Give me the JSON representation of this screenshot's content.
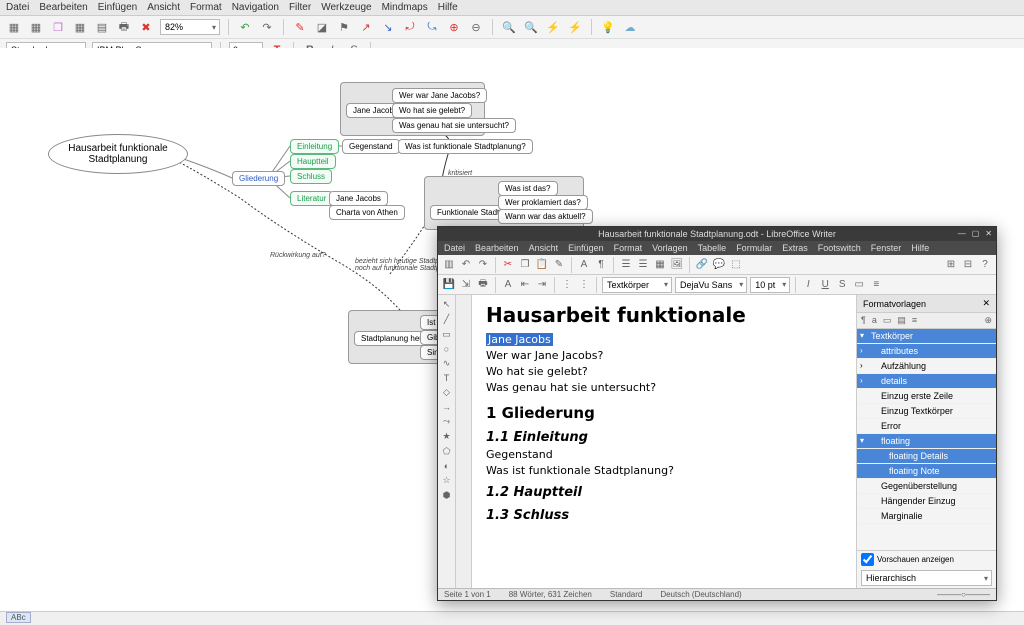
{
  "freeplane": {
    "menu": [
      "Datei",
      "Bearbeiten",
      "Einfügen",
      "Ansicht",
      "Format",
      "Navigation",
      "Filter",
      "Werkzeuge",
      "Mindmaps",
      "Hilfe"
    ],
    "zoom": "82%",
    "style_combo": "Standard",
    "font_combo": "IBM Plex Sans",
    "size_spin": "0",
    "status_abc": "ABc",
    "root": "Hausarbeit funktionale Stadtplanung",
    "gliederung": "Gliederung",
    "einleitung": "Einleitung",
    "hauptteil": "Hauptteil",
    "schluss": "Schluss",
    "literatur": "Literatur",
    "lit_items": [
      "Jane Jacobs",
      "Charta von Athen"
    ],
    "gegenstand": "Gegenstand",
    "was_ist": "Was ist funktionale Stadtplanung?",
    "jane_jacobs": "Jane Jacobs",
    "jj_q": [
      "Wer war Jane Jacobs?",
      "Wo hat sie gelebt?",
      "Was genau hat sie untersucht?"
    ],
    "funktionale": "Funktionale Stadtplanung",
    "f_q": [
      "Was ist das?",
      "Wer proklamiert das?",
      "Wann war das aktuell?"
    ],
    "ruckwirkung": "Rückwirkung auf?",
    "bezieht": "bezieht sich heutige Stadtplanung noch auf funktionale Stadtplanung?",
    "kritisiert": "kritisiert",
    "heute": "Stadtplanung heute",
    "heute_items": [
      "Ist fu…",
      "Gibt es…",
      "Sind u…"
    ]
  },
  "libre": {
    "title": "Hausarbeit funktionale Stadtplanung.odt - LibreOffice Writer",
    "menu": [
      "Datei",
      "Bearbeiten",
      "Ansicht",
      "Einfügen",
      "Format",
      "Vorlagen",
      "Tabelle",
      "Formular",
      "Extras",
      "Footswitch",
      "Fenster",
      "Hilfe"
    ],
    "para_style": "Textkörper",
    "font": "DejaVu Sans",
    "size": "10 pt",
    "doc": {
      "h1": "Hausarbeit funktionale",
      "sel": "Jane Jacobs",
      "p1": "Wer war Jane Jacobs?",
      "p2": "Wo hat sie gelebt?",
      "p3": "Was genau hat sie untersucht?",
      "h2_1": "1  Gliederung",
      "h3_11": "1.1  Einleitung",
      "p_g": "Gegenstand",
      "p_w": "Was ist funktionale Stadtplanung?",
      "h3_12": "1.2  Hauptteil",
      "h3_13": "1.3  Schluss"
    },
    "styles_title": "Formatvorlagen",
    "styles": [
      {
        "t": "Textkörper",
        "hl": true,
        "chev": "▾"
      },
      {
        "t": "attributes",
        "hl": true,
        "chev": "›",
        "indent": 1
      },
      {
        "t": "Aufzählung",
        "chev": "›",
        "indent": 1
      },
      {
        "t": "details",
        "hl": true,
        "chev": "›",
        "indent": 1
      },
      {
        "t": "Einzug erste Zeile",
        "indent": 1
      },
      {
        "t": "Einzug Textkörper",
        "indent": 1
      },
      {
        "t": "Error",
        "indent": 1
      },
      {
        "t": "floating",
        "hl": true,
        "chev": "▾",
        "indent": 1
      },
      {
        "t": "floating Details",
        "hl": true,
        "indent": 2
      },
      {
        "t": "floating Note",
        "hl": true,
        "indent": 2
      },
      {
        "t": "Gegenüberstellung",
        "indent": 1
      },
      {
        "t": "Hängender Einzug",
        "indent": 1
      },
      {
        "t": "Marginalie",
        "indent": 1
      }
    ],
    "preview_chk": "Vorschauen anzeigen",
    "filter": "Hierarchisch",
    "status": {
      "page": "Seite 1 von 1",
      "words": "88 Wörter, 631 Zeichen",
      "style": "Standard",
      "lang": "Deutsch (Deutschland)"
    }
  }
}
